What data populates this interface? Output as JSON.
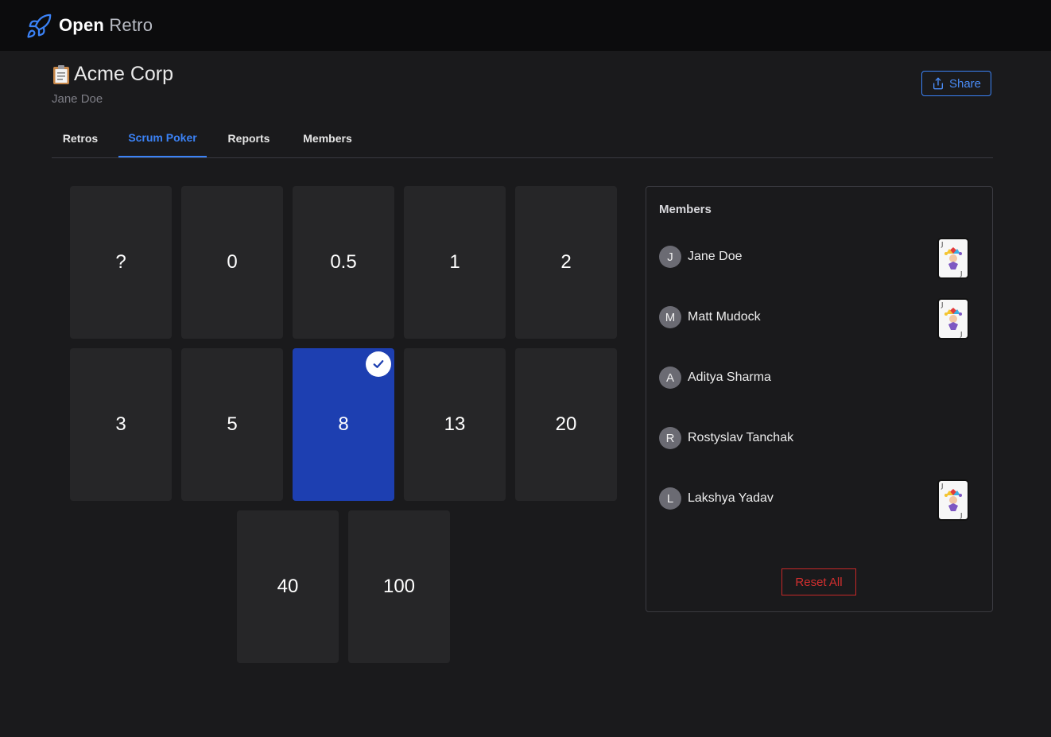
{
  "app": {
    "brand_primary": "Open",
    "brand_secondary": "Retro",
    "logo_icon": "rocket-icon"
  },
  "header": {
    "org_icon": "clipboard-icon",
    "org_name": "Acme Corp",
    "user": "Jane Doe",
    "share_label": "Share"
  },
  "tabs": [
    {
      "label": "Retros",
      "active": false
    },
    {
      "label": "Scrum Poker",
      "active": true
    },
    {
      "label": "Reports",
      "active": false
    },
    {
      "label": "Members",
      "active": false
    }
  ],
  "cards": [
    "?",
    "0",
    "0.5",
    "1",
    "2",
    "3",
    "5",
    "8",
    "13",
    "20",
    "40",
    "100"
  ],
  "selected_card": "8",
  "members_panel": {
    "title": "Members",
    "members": [
      {
        "initial": "J",
        "name": "Jane Doe",
        "voted": true
      },
      {
        "initial": "M",
        "name": "Matt Mudock",
        "voted": true
      },
      {
        "initial": "A",
        "name": "Aditya Sharma",
        "voted": false
      },
      {
        "initial": "R",
        "name": "Rostyslav Tanchak",
        "voted": false
      },
      {
        "initial": "L",
        "name": "Lakshya Yadav",
        "voted": true
      }
    ],
    "reset_label": "Reset All"
  },
  "colors": {
    "accent": "#3b82f6",
    "selected_card": "#1d3fb1",
    "danger": "#d32f2f"
  }
}
